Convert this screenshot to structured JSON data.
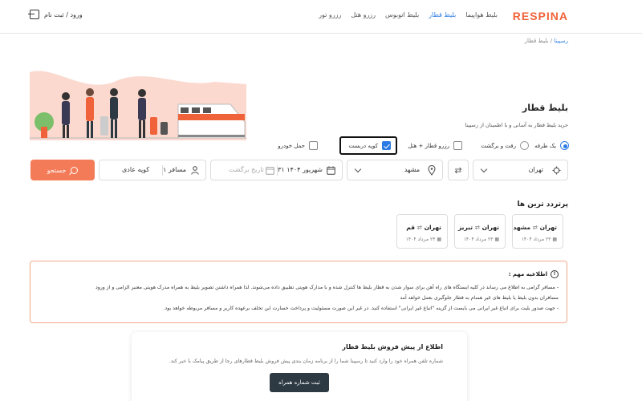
{
  "header": {
    "logo": "RESPINA",
    "nav": [
      "بلیط هواپیما",
      "بلیط قطار",
      "بلیط اتوبوس",
      "رزرو هتل",
      "رزرو تور"
    ],
    "active_nav": "بلیط قطار",
    "login": "ورود / ثبت نام"
  },
  "breadcrumb": {
    "home": "رسپینا",
    "separator": " / ",
    "current": "بلیط قطار"
  },
  "hero": {
    "title": "بلیط قطار",
    "subtitle": "خرید بلیط قطار به آسانی و با اطمینان از رسپینا"
  },
  "trip_options": {
    "one_way": "یک طرفه",
    "round_trip": "رفت و برگشت",
    "train_hotel": "رزرو قطار + هتل",
    "private_coupe": "کوپه دربست",
    "car_transport": "حمل خودرو",
    "selected_trip": "یک طرفه",
    "private_coupe_checked": true
  },
  "search": {
    "origin": "تهران",
    "destination": "مشهد",
    "depart_date": "۳۱ شهریور ۱۴۰۴",
    "return_placeholder": "تاریخ برگشت",
    "passengers": "۱ مسافر",
    "coupe_type": "کوپه عادی",
    "search_label": "جستجو"
  },
  "popular": {
    "title": "پرتردد ترین ها",
    "routes": [
      {
        "from": "تهران",
        "to": "مشهد",
        "date": "۲۳ مرداد ۱۴۰۴"
      },
      {
        "from": "تهران",
        "to": "تبریز",
        "date": "۲۳ مرداد ۱۴۰۴"
      },
      {
        "from": "تهران",
        "to": "قم",
        "date": "۲۳ مرداد ۱۴۰۴"
      }
    ]
  },
  "notice": {
    "title": "اطلاعیه مهم :",
    "lines": [
      "- مسافر گرامی به اطلاع می رساند در کلیه ایستگاه های راه آهن برای سوار شدن به قطار بلیط ها کنترل شده و با مدارک هویتی تطبیق داده می‌شوند. لذا همراه داشتن تصویر بلیط به همراه مدرک هویتی معتبر الزامی و از ورود",
      "مسافران بدون بلیط یا بلیط های غیر همنام به قطار جلوگیری بعمل خواهد آمد",
      "- جهت صدور بلیت برای اتباع غیر ایرانی می بایست از گزینه \"اتباع غیر ایرانی\" استفاده کنید. در غیر این صورت مسئولیت و پرداخت خسارت این تخلف برعهده کاربر و مسافر مربوطه خواهد بود."
    ]
  },
  "presale": {
    "title": "اطلاع از پیش فروش بلیط قطار",
    "desc": "شماره تلفن همراه خود را وارد کنید تا رسپینا شما را از برنامه زمان بندی پیش فروش بلیط قطارهای رجا از طریق پیامک با خبر کند.",
    "button": "ثبت شماره همراه"
  },
  "colors": {
    "accent": "#f0623a",
    "link": "#2b7be4",
    "search": "#f47b57",
    "dark_button": "#2d3a44"
  }
}
